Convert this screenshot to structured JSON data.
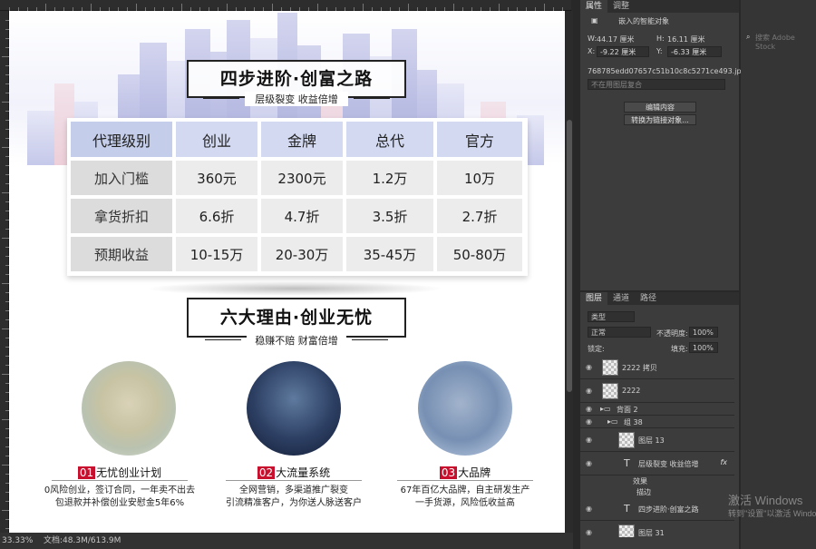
{
  "status": {
    "zoom": "33.33%",
    "doc": "文档:48.3M/613.9M"
  },
  "poster": {
    "title1": "四步进阶·创富之路",
    "subtitle1": "层级裂变 收益倍增",
    "table": {
      "headers": [
        "代理级别",
        "创业",
        "金牌",
        "总代",
        "官方"
      ],
      "rows": [
        {
          "label": "加入门槛",
          "values": [
            "360元",
            "2300元",
            "1.2万",
            "10万"
          ]
        },
        {
          "label": "拿货折扣",
          "values": [
            "6.6折",
            "4.7折",
            "3.5折",
            "2.7折"
          ]
        },
        {
          "label": "预期收益",
          "values": [
            "10-15万",
            "20-30万",
            "35-45万",
            "50-80万"
          ]
        }
      ]
    },
    "title2": "六大理由·创业无忧",
    "subtitle2": "稳赚不赔 财富倍增",
    "reasons": [
      {
        "num": "01",
        "title": "无忧创业计划",
        "desc1": "0风险创业，签订合同，一年卖不出去",
        "desc2": "包退款并补偿创业安慰金5年6%"
      },
      {
        "num": "02",
        "title": "大流量系统",
        "desc1": "全网营销，多渠道推广裂变",
        "desc2": "引流精准客户，为你送人脉送客户"
      },
      {
        "num": "03",
        "title": "大品牌",
        "desc1": "67年百亿大品牌，自主研发生产",
        "desc2": "一手货源，风险低收益高"
      }
    ]
  },
  "properties": {
    "tabs": [
      "属性",
      "调整"
    ],
    "type_label": "嵌入的智能对象",
    "w_label": "W:",
    "w": "44.17 厘米",
    "h_label": "H:",
    "h": "16.11 厘米",
    "x_label": "X:",
    "x": "-9.22 厘米",
    "y_label": "Y:",
    "y": "-6.33 厘米",
    "file": "768785edd07657c51b10c8c5271ce493.jpg",
    "comp_placeholder": "不在用图层复合",
    "edit_btn": "编辑内容",
    "convert_btn": "转换为链接对象..."
  },
  "search": {
    "placeholder": "搜索 Adobe Stock"
  },
  "layers": {
    "tabs": [
      "图层",
      "通道",
      "路径"
    ],
    "filter": "类型",
    "blend": "正常",
    "opacity_label": "不透明度:",
    "opacity": "100%",
    "lock_label": "锁定:",
    "fill_label": "填充:",
    "fill": "100%",
    "items": [
      {
        "name": "2222 拷贝"
      },
      {
        "name": "2222"
      },
      {
        "name": "背面 2"
      },
      {
        "name": "组 38"
      },
      {
        "name": "图层 13"
      },
      {
        "name": "层级裂变 收益倍增"
      },
      {
        "name": "效果"
      },
      {
        "name": "描边"
      },
      {
        "name": "四步进阶·创富之路"
      },
      {
        "name": "图层 31"
      }
    ]
  },
  "watermark": {
    "line1": "激活 Windows",
    "line2": "转到\"设置\"以激活 Windows。"
  }
}
